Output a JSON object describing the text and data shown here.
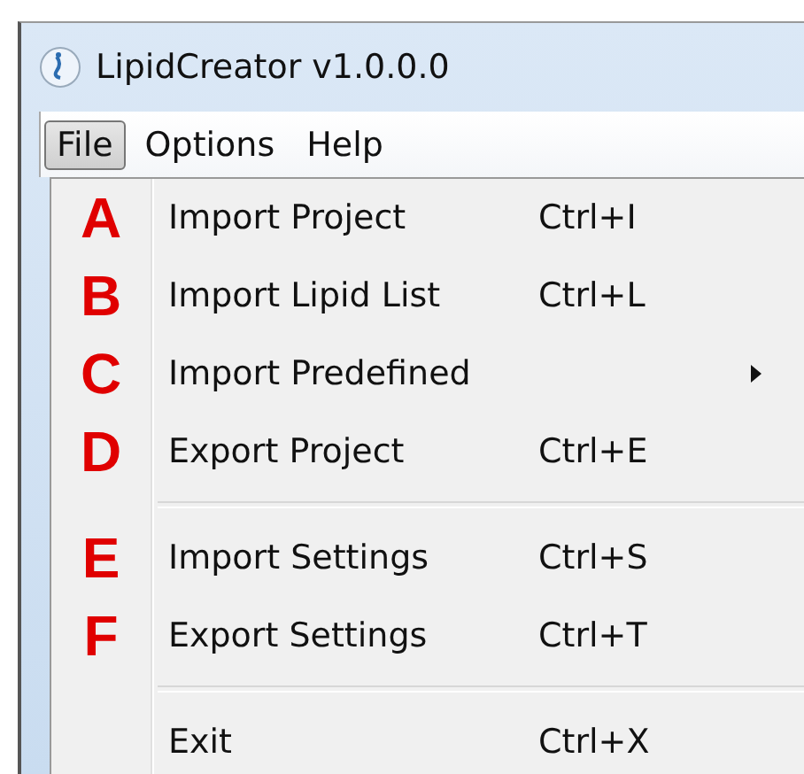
{
  "window": {
    "title": "LipidCreator  v1.0.0.0"
  },
  "menu_bar": [
    {
      "label": "File",
      "selected": true
    },
    {
      "label": "Options",
      "selected": false
    },
    {
      "label": "Help",
      "selected": false
    }
  ],
  "file_menu": [
    {
      "kind": "item",
      "annotation": "A",
      "label": "Import Project",
      "shortcut": "Ctrl+I",
      "submenu": false
    },
    {
      "kind": "item",
      "annotation": "B",
      "label": "Import Lipid List",
      "shortcut": "Ctrl+L",
      "submenu": false
    },
    {
      "kind": "item",
      "annotation": "C",
      "label": "Import Predefined",
      "submenu": true
    },
    {
      "kind": "item",
      "annotation": "D",
      "label": "Export Project",
      "shortcut": "Ctrl+E",
      "submenu": false
    },
    {
      "kind": "separator"
    },
    {
      "kind": "item",
      "annotation": "E",
      "label": "Import Settings",
      "shortcut": "Ctrl+S",
      "submenu": false
    },
    {
      "kind": "item",
      "annotation": "F",
      "label": "Export Settings",
      "shortcut": "Ctrl+T",
      "submenu": false
    },
    {
      "kind": "separator"
    },
    {
      "kind": "item",
      "label": "Exit",
      "shortcut": "Ctrl+X",
      "submenu": false
    }
  ]
}
